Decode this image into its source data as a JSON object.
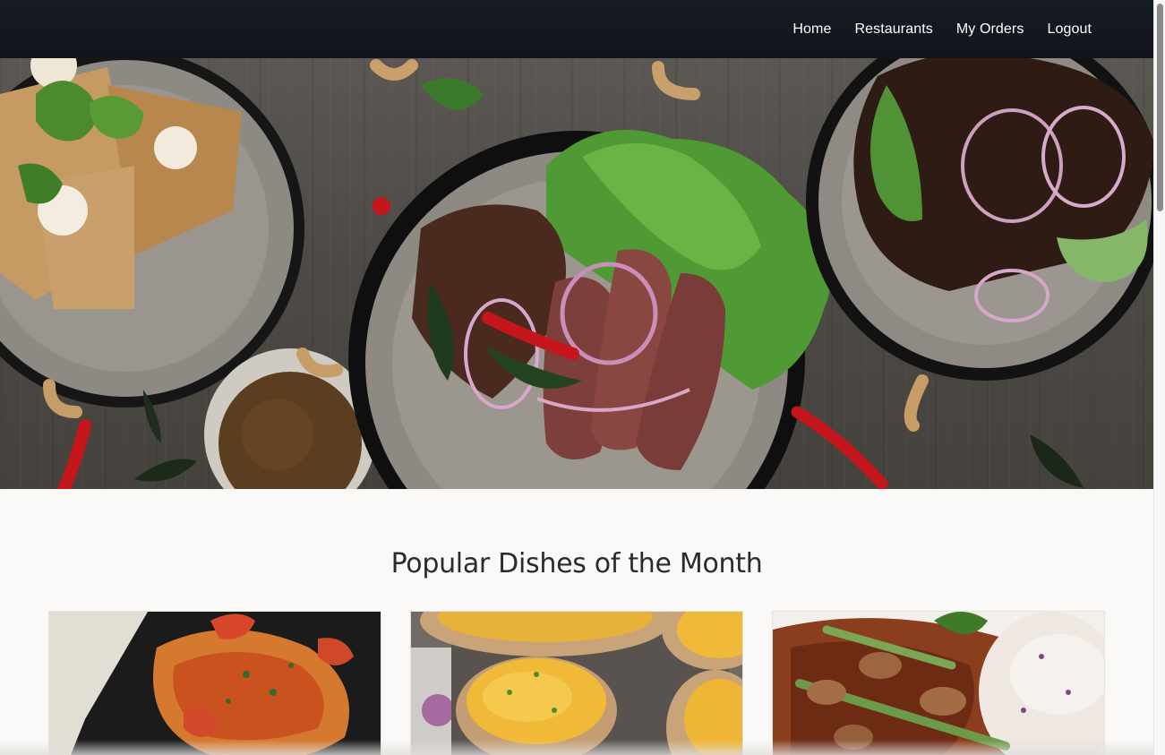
{
  "nav": {
    "links": [
      {
        "label": "Home"
      },
      {
        "label": "Restaurants"
      },
      {
        "label": "My Orders"
      },
      {
        "label": "Logout"
      }
    ]
  },
  "popular": {
    "title": "Popular Dishes of the Month"
  },
  "colors": {
    "navbar_bg": "#14171e",
    "page_bg": "#faf9f7",
    "title_text": "#2b2b2b"
  }
}
